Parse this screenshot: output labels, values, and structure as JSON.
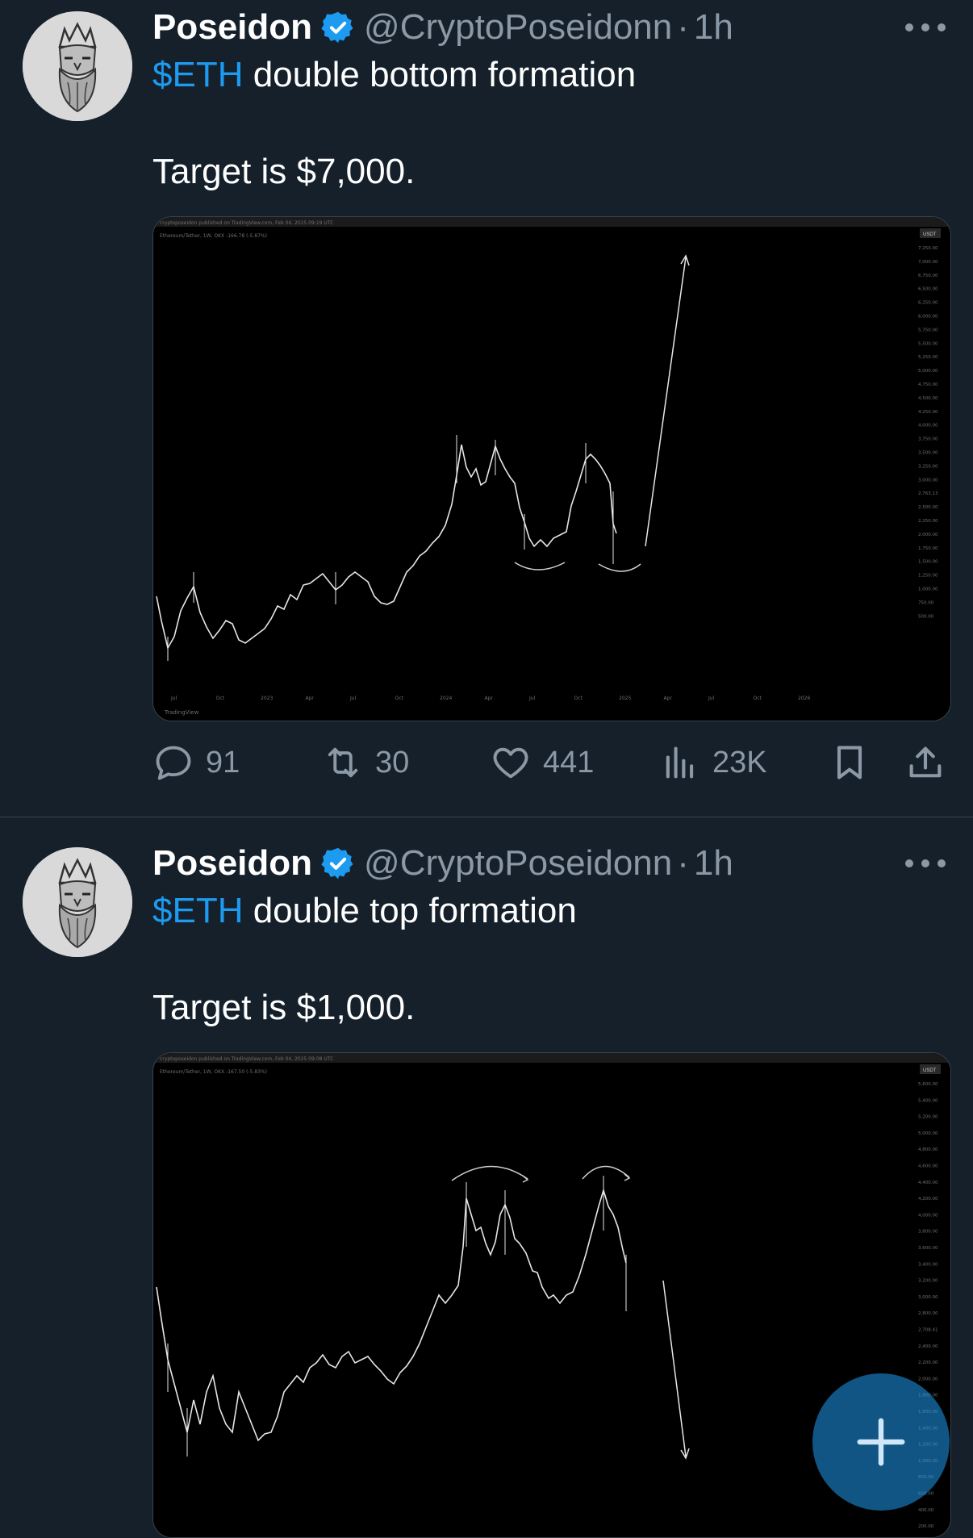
{
  "tweets": [
    {
      "author": "Poseidon",
      "handle": "@CryptoPoseidonn",
      "separator": "·",
      "time": "1h",
      "cashtag": "$ETH",
      "headline": " double bottom formation",
      "target": "Target is $7,000.",
      "chart": {
        "watermark": "cryptoposeidon published on TradingView.com, Feb 04, 2025 09:19 UTC",
        "symbol": "Ethereum/Tether, 1W, OKX  -166.78 (-5.87%)",
        "currency": "USDT",
        "price_labels": [
          "7,250.00",
          "7,000.00",
          "6,750.00",
          "6,500.00",
          "6,250.00",
          "6,000.00",
          "5,750.00",
          "5,500.00",
          "5,250.00",
          "5,000.00",
          "4,750.00",
          "4,500.00",
          "4,250.00",
          "4,000.00",
          "3,750.00",
          "3,500.00",
          "3,250.00",
          "3,000.00",
          "2,763.13",
          "2,500.00",
          "2,250.00",
          "2,000.00",
          "1,750.00",
          "1,500.00",
          "1,250.00",
          "1,000.00",
          "750.00",
          "500.00"
        ],
        "time_labels": [
          "Jul",
          "Oct",
          "2023",
          "Apr",
          "Jul",
          "Oct",
          "2024",
          "Apr",
          "Jul",
          "Oct",
          "2025",
          "Apr",
          "Jul",
          "Oct",
          "2026"
        ],
        "footer": "TradingView"
      },
      "stats": {
        "replies": "91",
        "reposts": "30",
        "likes": "441",
        "views": "23K"
      }
    },
    {
      "author": "Poseidon",
      "handle": "@CryptoPoseidonn",
      "separator": "·",
      "time": "1h",
      "cashtag": "$ETH",
      "headline": " double top formation",
      "target": "Target is $1,000.",
      "chart": {
        "watermark": "cryptoposeidon published on TradingView.com, Feb 04, 2025 09:08 UTC",
        "symbol": "Ethereum/Tether, 1W, OKX  -167.50 (-5.83%)",
        "currency": "USDT",
        "price_labels": [
          "5,600.00",
          "5,400.00",
          "5,200.00",
          "5,000.00",
          "4,800.00",
          "4,600.00",
          "4,400.00",
          "4,200.00",
          "4,000.00",
          "3,800.00",
          "3,600.00",
          "3,400.00",
          "3,200.00",
          "3,000.00",
          "2,800.00",
          "2,708.41",
          "2,400.00",
          "2,200.00",
          "2,000.00",
          "1,800.00",
          "1,600.00",
          "1,400.00",
          "1,200.00",
          "1,000.00",
          "800.00",
          "600.00",
          "400.00",
          "200.00"
        ]
      }
    }
  ],
  "icons": {
    "verified": "verified-badge-icon",
    "more": "more-dots-icon",
    "reply": "reply-bubble-icon",
    "repost": "repost-icon",
    "like": "heart-icon",
    "views": "views-bar-icon",
    "bookmark": "bookmark-icon",
    "share": "share-icon",
    "compose": "plus-icon"
  },
  "colors": {
    "background": "#15202b",
    "accent": "#1d9bf0",
    "muted": "#8b98a5"
  }
}
